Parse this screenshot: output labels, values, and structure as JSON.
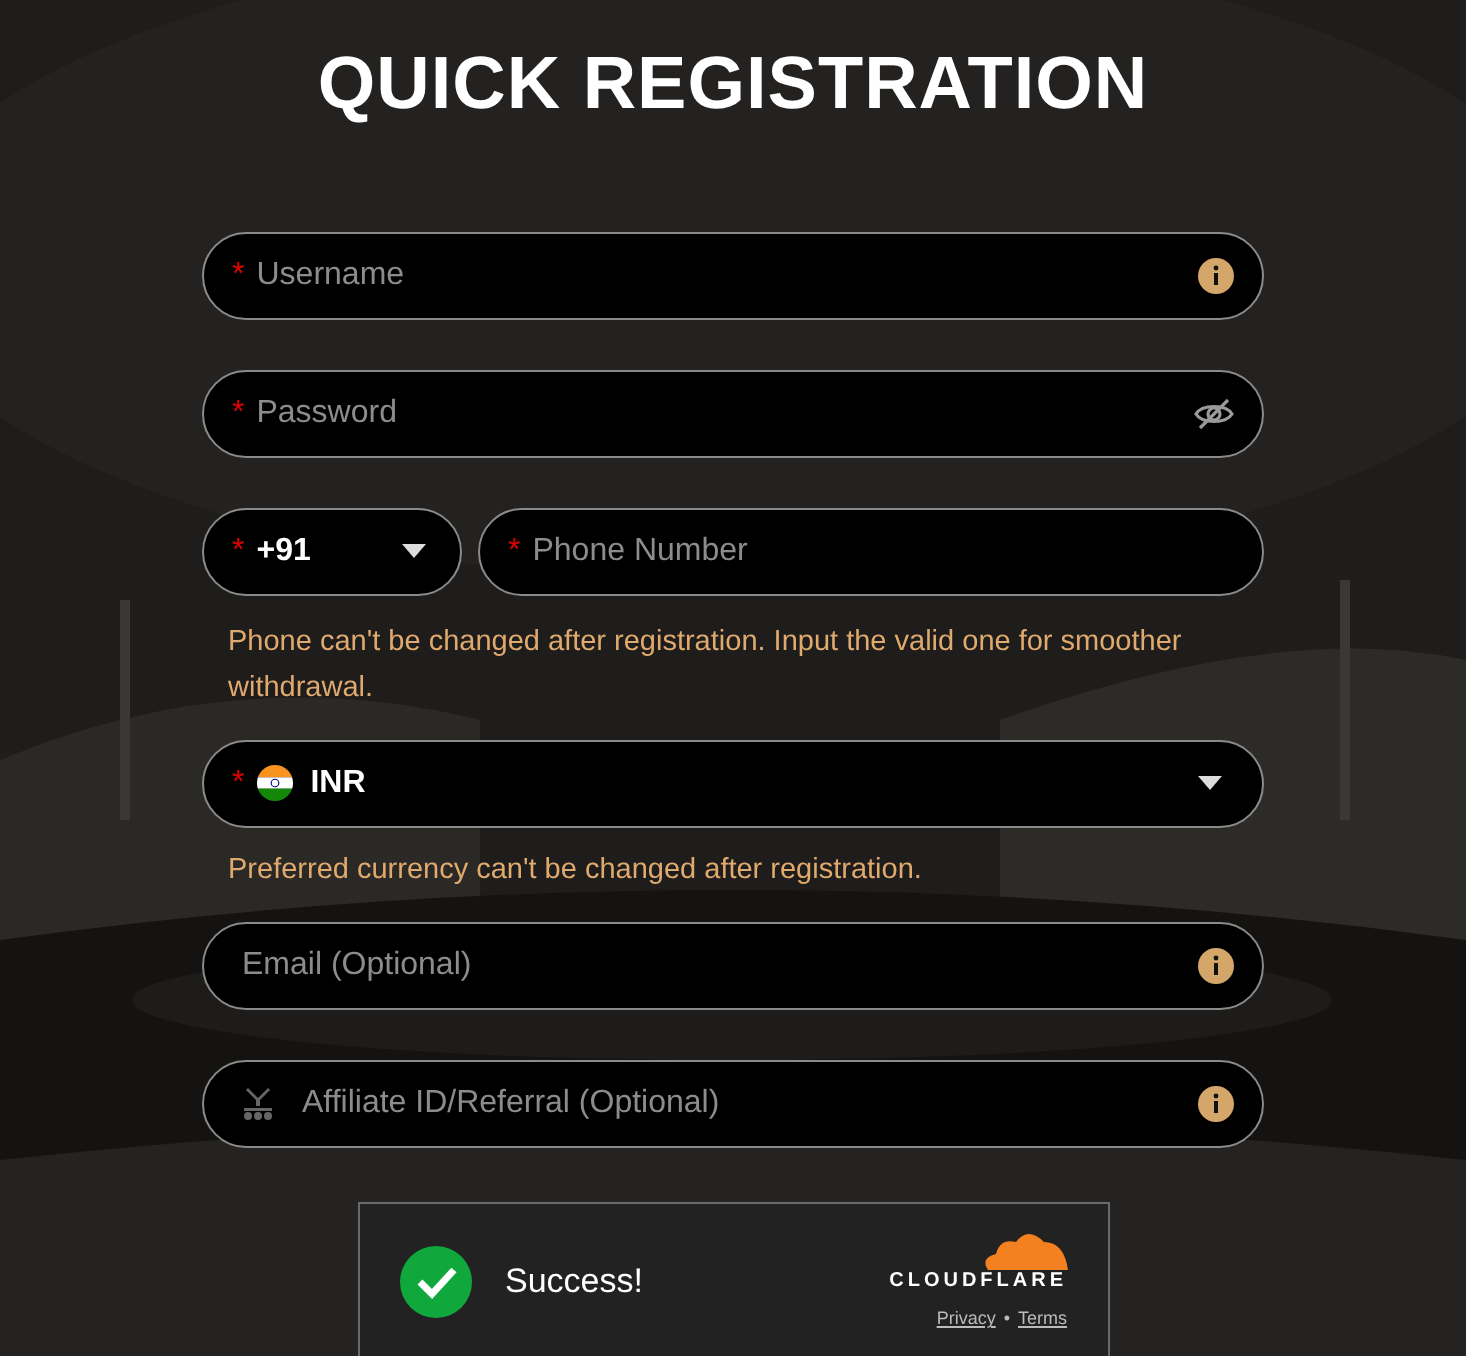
{
  "title": "QUICK REGISTRATION",
  "items": [
    {
      "kind": "text",
      "mark": "*",
      "placeholder": "Username"
    },
    {
      "kind": "password",
      "mark": "*",
      "placeholder": "Password"
    },
    {
      "kind": "phone",
      "code": {
        "mark": "*",
        "value": "+91"
      },
      "number": {
        "mark": "*",
        "placeholder": "Phone Number"
      }
    },
    {
      "kind": "note",
      "text": "Phone can't be changed after registration. Input the valid one for smoother withdrawal."
    },
    {
      "kind": "select",
      "mark": "*",
      "value": "INR"
    },
    {
      "kind": "note",
      "text": "Preferred currency can't be changed after registration."
    },
    {
      "kind": "text",
      "placeholder": "Email (Optional)"
    },
    {
      "kind": "referral",
      "placeholder": "Affiliate ID/Referral (Optional)"
    }
  ],
  "captcha": {
    "status": "Success!",
    "brand": "CLOUDFLARE",
    "links": [
      "Privacy",
      "Terms"
    ],
    "separator": "•"
  }
}
